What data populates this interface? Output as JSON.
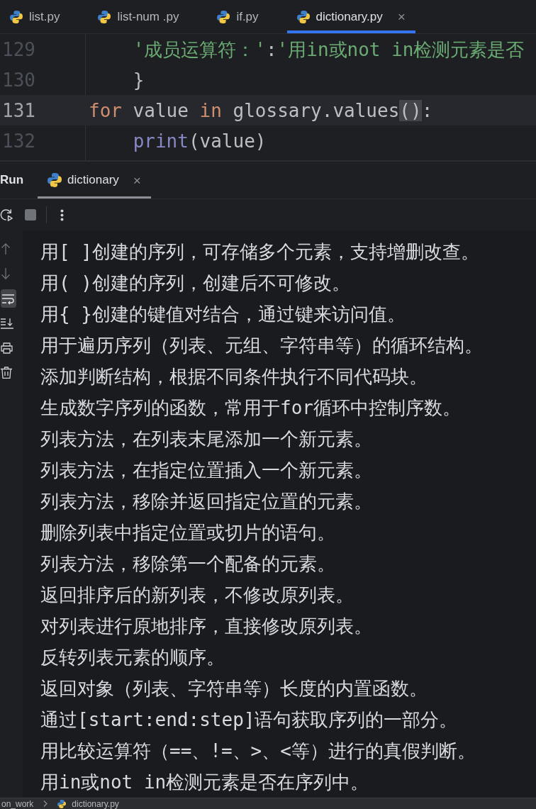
{
  "editor": {
    "tabs": [
      {
        "label": "list.py",
        "selected": false
      },
      {
        "label": "list-num .py",
        "selected": false
      },
      {
        "label": "if.py",
        "selected": false
      },
      {
        "label": "dictionary.py",
        "selected": true,
        "close": "×"
      }
    ],
    "lines": [
      {
        "number": "129",
        "current": false,
        "tokens": [
          {
            "kind": "string",
            "text": "    '成员运算符：'"
          },
          {
            "kind": "plain",
            "text": ":"
          },
          {
            "kind": "string",
            "text": "'用in或not in检测元素是否"
          }
        ]
      },
      {
        "number": "130",
        "current": false,
        "tokens": [
          {
            "kind": "plain",
            "text": "    }"
          }
        ]
      },
      {
        "number": "131",
        "current": true,
        "tokens": [
          {
            "kind": "keyword",
            "text": "for"
          },
          {
            "kind": "plain",
            "text": " value "
          },
          {
            "kind": "keyword",
            "text": "in"
          },
          {
            "kind": "plain",
            "text": " glossary.values"
          },
          {
            "kind": "matched-brace",
            "text": "()"
          },
          {
            "kind": "plain",
            "text": ":"
          }
        ]
      },
      {
        "number": "132",
        "current": false,
        "tokens": [
          {
            "kind": "builtin",
            "text": "    print"
          },
          {
            "kind": "plain",
            "text": "(value)"
          }
        ]
      }
    ]
  },
  "run": {
    "title": "Run",
    "tabs": [
      {
        "label": "dictionary",
        "selected": true,
        "close": "×"
      }
    ],
    "soft_wrap": {
      "on": true
    },
    "output": [
      "用[ ]创建的序列，可存储多个元素，支持增删改查。",
      "用( )创建的序列，创建后不可修改。",
      "用{ }创建的键值对结合，通过键来访问值。",
      "用于遍历序列（列表、元组、字符串等）的循环结构。",
      "添加判断结构，根据不同条件执行不同代码块。",
      "生成数字序列的函数，常用于for循环中控制序数。",
      "列表方法，在列表末尾添加一个新元素。",
      "列表方法，在指定位置插入一个新元素。",
      "列表方法，移除并返回指定位置的元素。",
      "删除列表中指定位置或切片的语句。",
      "列表方法，移除第一个配备的元素。",
      "返回排序后的新列表，不修改原列表。",
      "对列表进行原地排序，直接修改原列表。",
      "反转列表元素的顺序。",
      "返回对象（列表、字符串等）长度的内置函数。",
      "通过[start:end:step]语句获取序列的一部分。",
      "用比较运算符（==、!=、>、<等）进行的真假判断。",
      "用in或not in检测元素是否在序列中。"
    ]
  },
  "status_bar": {
    "breadcrumbs": [
      {
        "kind": "folder",
        "label": "on_work"
      },
      {
        "kind": "file",
        "label": "dictionary.py"
      }
    ]
  }
}
